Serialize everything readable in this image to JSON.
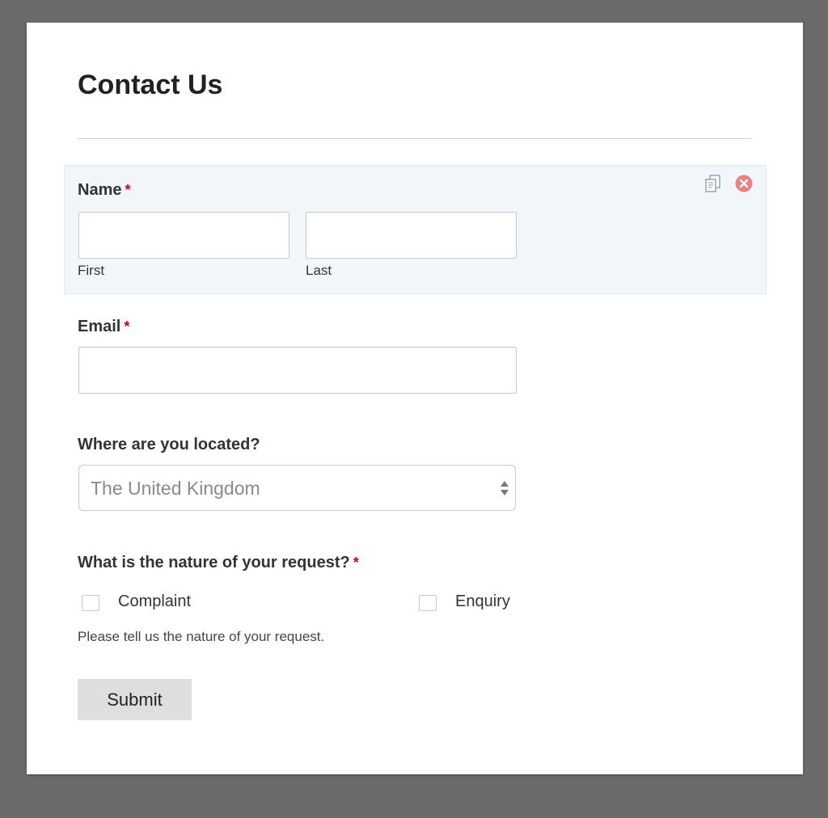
{
  "form": {
    "title": "Contact Us",
    "name_field": {
      "label": "Name",
      "required_mark": "*",
      "first_sublabel": "First",
      "last_sublabel": "Last",
      "first_value": "",
      "last_value": ""
    },
    "email_field": {
      "label": "Email",
      "required_mark": "*",
      "value": ""
    },
    "location_field": {
      "label": "Where are you located?",
      "selected_value": "The United Kingdom"
    },
    "request_field": {
      "label": "What is the nature of your request?",
      "required_mark": "*",
      "options": [
        {
          "label": "Complaint",
          "checked": false
        },
        {
          "label": "Enquiry",
          "checked": false
        }
      ],
      "helper_text": "Please tell us the nature of your request."
    },
    "submit_label": "Submit"
  },
  "field_actions": {
    "duplicate_icon": "duplicate-icon",
    "delete_icon": "delete-icon"
  },
  "colors": {
    "required": "#d0021b",
    "delete_icon": "#e8817f",
    "highlight_bg": "#f1f6fb",
    "backdrop": "#6b6b6b"
  }
}
